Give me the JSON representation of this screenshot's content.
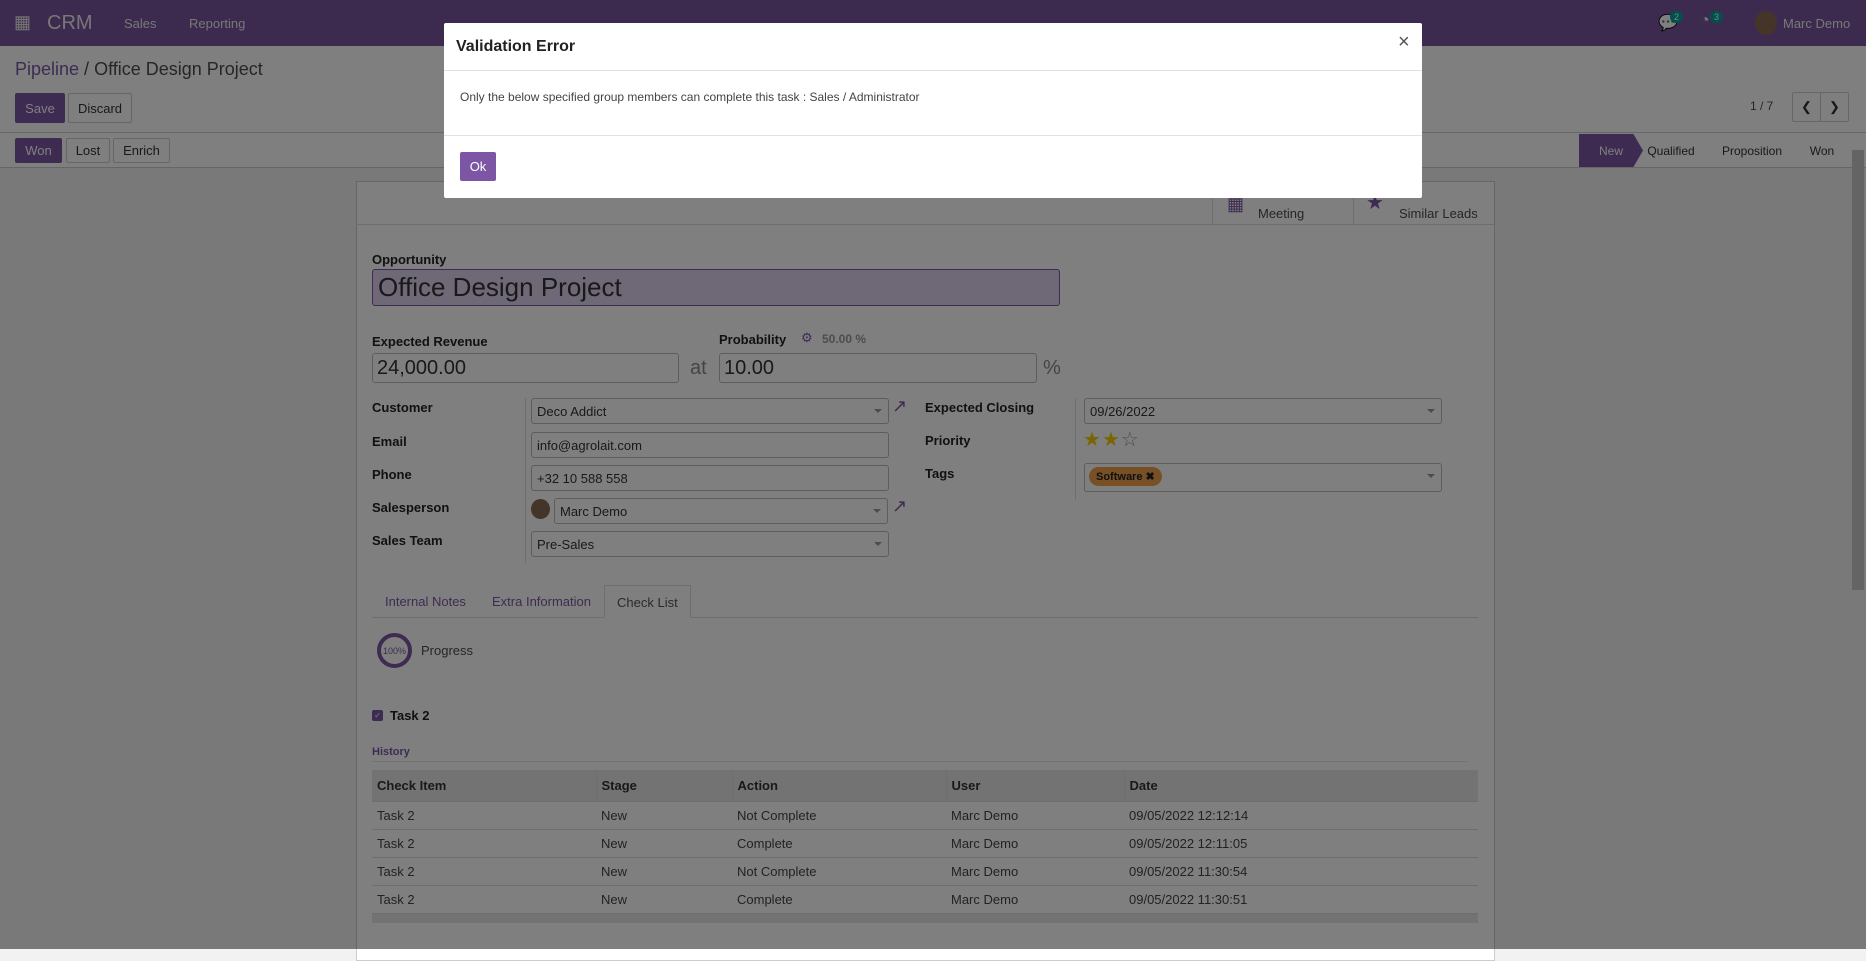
{
  "nav": {
    "app": "CRM",
    "menu": [
      "Sales",
      "Reporting"
    ],
    "chat_count": "2",
    "activity_count": "3",
    "user": "Marc Demo",
    "brand_color": "#7a549e"
  },
  "breadcrumb": {
    "parent": "Pipeline",
    "current": "Office Design Project"
  },
  "toolbar": {
    "save": "Save",
    "discard": "Discard",
    "pager": "1 / 7"
  },
  "actions": [
    "Won",
    "Lost",
    "Enrich"
  ],
  "stages": [
    "New",
    "Qualified",
    "Proposition",
    "Won"
  ],
  "smart_buttons": {
    "meeting": "Meeting",
    "similar": "Similar Leads"
  },
  "form": {
    "opportunity_label": "Opportunity",
    "opportunity": "Office Design Project",
    "revenue_label": "Expected Revenue",
    "revenue": "24,000.00",
    "at": "at",
    "probability_label": "Probability",
    "auto_probability": "50.00 %",
    "probability": "10.00",
    "percent": "%",
    "customer_label": "Customer",
    "customer": "Deco Addict",
    "email_label": "Email",
    "email": "info@agrolait.com",
    "phone_label": "Phone",
    "phone": "+32 10 588 558",
    "salesperson_label": "Salesperson",
    "salesperson": "Marc Demo",
    "team_label": "Sales Team",
    "team": "Pre-Sales",
    "closing_label": "Expected Closing",
    "closing": "09/26/2022",
    "priority_label": "Priority",
    "priority": 2,
    "priority_max": 3,
    "tags_label": "Tags",
    "tag": "Software"
  },
  "tabs": [
    "Internal Notes",
    "Extra Information",
    "Check List"
  ],
  "checklist": {
    "progress": "100%",
    "progress_label": "Progress",
    "task": "Task 2",
    "history_label": "History",
    "columns": [
      "Check Item",
      "Stage",
      "Action",
      "User",
      "Date"
    ],
    "rows": [
      [
        "Task 2",
        "New",
        "Not Complete",
        "Marc Demo",
        "09/05/2022 12:12:14"
      ],
      [
        "Task 2",
        "New",
        "Complete",
        "Marc Demo",
        "09/05/2022 12:11:05"
      ],
      [
        "Task 2",
        "New",
        "Not Complete",
        "Marc Demo",
        "09/05/2022 11:30:54"
      ],
      [
        "Task 2",
        "New",
        "Complete",
        "Marc Demo",
        "09/05/2022 11:30:51"
      ]
    ]
  },
  "modal": {
    "title": "Validation Error",
    "close": "×",
    "message": "Only the below specified group members can complete this task : Sales / Administrator",
    "ok": "Ok"
  }
}
